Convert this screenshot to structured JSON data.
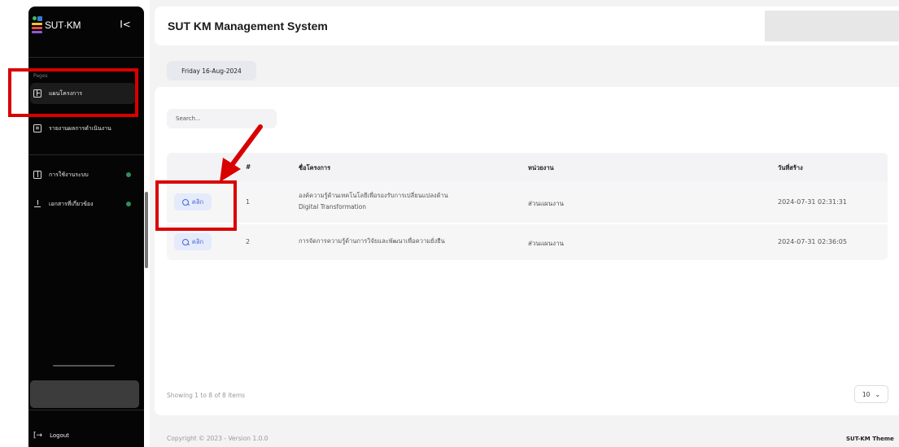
{
  "sidebar": {
    "logo_text": "SUT·KM",
    "collapse_glyph": "I<",
    "section_label": "Pages",
    "items": [
      {
        "label": "แผนโครงการ",
        "icon": "grid-layout-icon",
        "active": true
      },
      {
        "label": "รายงานผลการดำเนินงาน",
        "icon": "report-lines-icon"
      },
      {
        "label": "การใช้งานระบบ",
        "icon": "split-panel-icon",
        "status_color": "#2f8f5b"
      },
      {
        "label": "เอกสารที่เกี่ยวข้อง",
        "icon": "download-icon",
        "status_color": "#2f8f5b"
      }
    ],
    "logout_label": "Logout"
  },
  "header": {
    "title": "SUT KM Management System"
  },
  "date_chip": "Friday 16-Aug-2024",
  "search": {
    "placeholder": "Search..."
  },
  "table": {
    "columns": [
      "#",
      "ชื่อโครงการ",
      "หน่วยงาน",
      "วันที่สร้าง"
    ],
    "action_label": "คลิก",
    "rows": [
      {
        "no": "1",
        "name_line1": "องค์ความรู้ด้านเทคโนโลยีเพื่อรองรับการเปลี่ยนแปลงด้าน",
        "name_line2": "Digital Transformation",
        "unit": "ส่วนแผนงาน",
        "created": "2024-07-31 02:31:31"
      },
      {
        "no": "2",
        "name_line1": "การจัดการความรู้ด้านการวิจัยและพัฒนาเพื่อความยั่งยืน",
        "name_line2": "",
        "unit": "ส่วนแผนงาน",
        "created": "2024-07-31 02:36:05"
      }
    ]
  },
  "pagination": {
    "info": "Showing 1 to 8 of 8 items",
    "page_size": "10"
  },
  "footer": {
    "copyright": "Copyright © 2023 - Version 1.0.0",
    "theme": "SUT-KM Theme"
  },
  "colors": {
    "sidebar_bg": "#050505",
    "accent_blue": "#4a64d6",
    "annotation_red": "#d90000",
    "status_green": "#2f8f5b"
  }
}
